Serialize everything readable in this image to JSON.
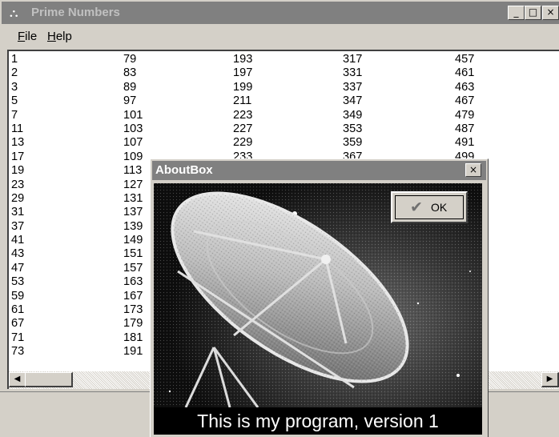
{
  "window": {
    "title": "Prime Numbers",
    "icon": "satellite-dish-icon",
    "minimize_glyph": "_",
    "maximize_glyph": "□",
    "close_glyph": "×"
  },
  "menu": {
    "file_accel": "F",
    "file_rest": "ile",
    "help_accel": "H",
    "help_rest": "elp"
  },
  "columns": [
    [
      "1",
      "2",
      "3",
      "5",
      "7",
      "11",
      "13",
      "17",
      "19",
      "23",
      "29",
      "31",
      "37",
      "41",
      "43",
      "47",
      "53",
      "59",
      "61",
      "67",
      "71",
      "73"
    ],
    [
      "79",
      "83",
      "89",
      "97",
      "101",
      "103",
      "107",
      "109",
      "113",
      "127",
      "131",
      "137",
      "139",
      "149",
      "151",
      "157",
      "163",
      "167",
      "173",
      "179",
      "181",
      "191"
    ],
    [
      "193",
      "197",
      "199",
      "211",
      "223",
      "227",
      "229",
      "233"
    ],
    [
      "317",
      "331",
      "337",
      "347",
      "349",
      "353",
      "359",
      "367"
    ],
    [
      "457",
      "461",
      "463",
      "467",
      "479",
      "487",
      "491",
      "499"
    ]
  ],
  "scrollbar": {
    "left_arrow": "◀",
    "right_arrow": "▶"
  },
  "about": {
    "title": "AboutBox",
    "close_glyph": "×",
    "ok_label": "OK",
    "ok_icon": "checkmark-icon",
    "caption": "This is my program, version 1"
  }
}
